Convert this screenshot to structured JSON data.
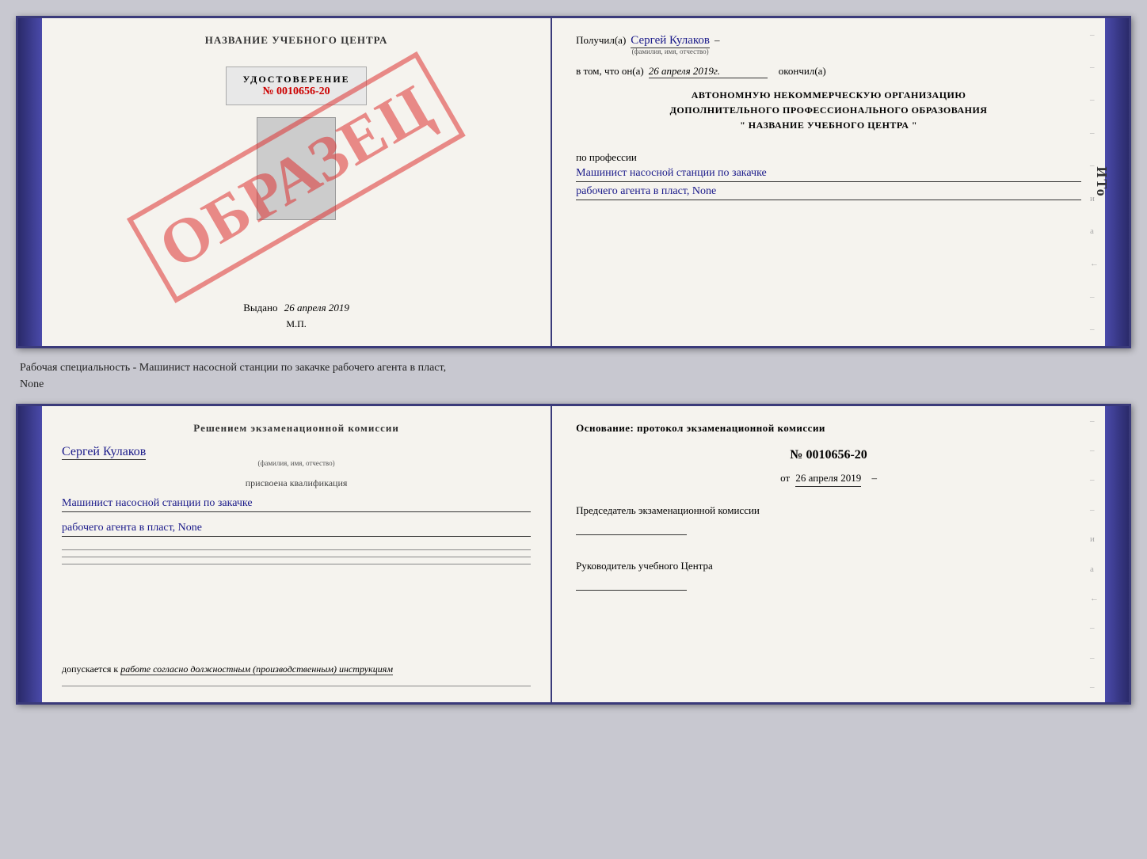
{
  "top_cert": {
    "left": {
      "title": "НАЗВАНИЕ УЧЕБНОГО ЦЕНТРА",
      "watermark": "ОБРАЗЕЦ",
      "udostoverenie_label": "УДОСТОВЕРЕНИЕ",
      "number": "№ 0010656-20",
      "vydano_label": "Выдано",
      "vydano_date": "26 апреля 2019",
      "mp": "М.П."
    },
    "right": {
      "poluchil_label": "Получил(а)",
      "recipient_name": "Сергей Кулаков",
      "fio_hint": "(фамилия, имя, отчество)",
      "vtom_label": "в том, что он(а)",
      "date_val": "26 апреля 2019г.",
      "okonchil_label": "окончил(а)",
      "org_line1": "АВТОНОМНУЮ НЕКОММЕРЧЕСКУЮ ОРГАНИЗАЦИЮ",
      "org_line2": "ДОПОЛНИТЕЛЬНОГО ПРОФЕССИОНАЛЬНОГО ОБРАЗОВАНИЯ",
      "org_line3": "\" НАЗВАНИЕ УЧЕБНОГО ЦЕНТРА \"",
      "po_professii": "по профессии",
      "profession1": "Машинист насосной станции по закачке",
      "profession2": "рабочего агента в пласт, None"
    }
  },
  "between": {
    "text1": "Рабочая специальность - Машинист насосной станции по закачке рабочего агента в пласт,",
    "text2": "None"
  },
  "bottom_cert": {
    "left": {
      "komissia_title": "Решением экзаменационной комиссии",
      "name": "Сергей Кулаков",
      "fio_hint": "(фамилия, имя, отчество)",
      "prisvoena": "присвоена квалификация",
      "qualification1": "Машинист насосной станции по закачке",
      "qualification2": "рабочего агента в пласт, None",
      "dopuskaetsya_label": "допускается к",
      "dopusk_text": "работе согласно должностным (производственным) инструкциям"
    },
    "right": {
      "osnovanie_title": "Основание: протокол экзаменационной комиссии",
      "protocol_number": "№ 0010656-20",
      "ot_label": "от",
      "ot_date": "26 апреля 2019",
      "predsedatel_label": "Председатель экзаменационной комиссии",
      "rukovoditel_label": "Руководитель учебного Центра"
    }
  },
  "ito_mark": "ИTo"
}
